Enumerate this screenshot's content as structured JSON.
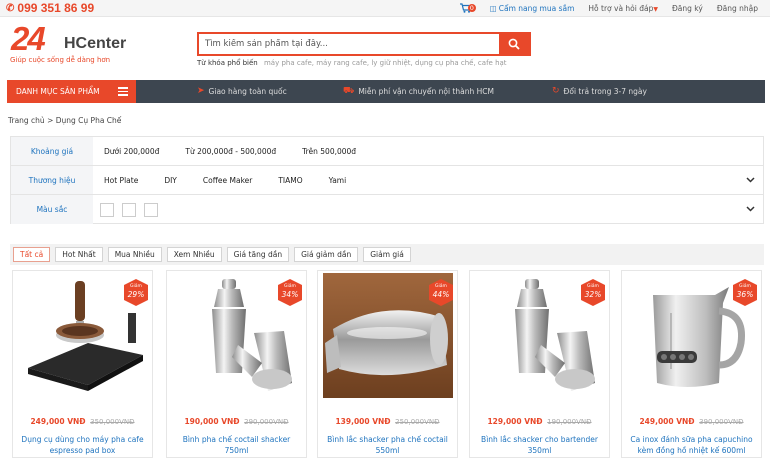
{
  "topbar": {
    "hotline": "099 351 86 99",
    "cart_count": "0",
    "links": {
      "guide": "Cẩm nang mua sắm",
      "help": "Hỗ trợ và hỏi đáp",
      "register": "Đăng ký",
      "login": "Đăng nhập"
    }
  },
  "logo": {
    "number": "24",
    "word": "HCenter",
    "tagline": "Giúp cuộc sống dễ dàng hơn"
  },
  "search": {
    "placeholder": "Tìm kiếm sản phẩm tại đây...",
    "keywords_label": "Từ khóa phổ biến",
    "keywords": "máy pha cafe, máy rang cafe, ly giữ nhiệt, dụng cụ pha chế, cafe hạt"
  },
  "nav": {
    "category_label": "DANH MỤC SẢN PHẨM",
    "features": [
      {
        "label": "Giao hàng toàn quốc",
        "icon": "rocket-icon"
      },
      {
        "label": "Miễn phí vận chuyển nội thành HCM",
        "icon": "truck-icon"
      },
      {
        "label": "Đổi trả trong 3-7 ngày",
        "icon": "return-icon"
      }
    ]
  },
  "breadcrumb": "Trang chủ > Dụng Cụ Pha Chế",
  "filters": {
    "price": {
      "label": "Khoảng giá",
      "options": [
        "Dưới 200,000đ",
        "Từ 200,000đ - 500,000đ",
        "Trên 500,000đ"
      ]
    },
    "brand": {
      "label": "Thương hiệu",
      "options": [
        "Hot Plate",
        "DIY",
        "Coffee Maker",
        "TIAMO",
        "Yami"
      ]
    },
    "color": {
      "label": "Màu sắc"
    }
  },
  "sort": [
    "Tất cả",
    "Hot Nhất",
    "Mua Nhiều",
    "Xem Nhiều",
    "Giá tăng dần",
    "Giá giảm dần",
    "Giảm giá"
  ],
  "sale_prefix": "Giảm",
  "products": [
    {
      "name": "Dụng cụ dùng cho máy pha cafe espresso pad box",
      "price": "249,000 VNĐ",
      "old_price": "350,000VNĐ",
      "discount": "29%"
    },
    {
      "name": "Bình pha chế coctail shacker 750ml",
      "price": "190,000 VNĐ",
      "old_price": "290,000VNĐ",
      "discount": "34%"
    },
    {
      "name": "Bình lắc shacker pha chế coctail 550ml",
      "price": "139,000 VNĐ",
      "old_price": "250,000VNĐ",
      "discount": "44%"
    },
    {
      "name": "Bình lắc shacker cho bartender 350ml",
      "price": "129,000 VNĐ",
      "old_price": "190,000VNĐ",
      "discount": "32%"
    },
    {
      "name": "Ca inox đánh sữa pha capuchino kèm đồng hồ nhiệt kế 600ml",
      "price": "249,000 VNĐ",
      "old_price": "390,000VNĐ",
      "discount": "36%"
    }
  ]
}
